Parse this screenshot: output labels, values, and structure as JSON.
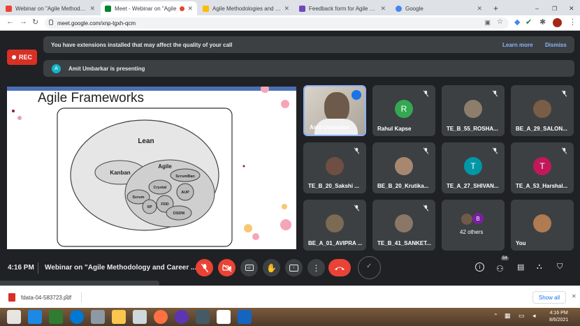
{
  "browser": {
    "tabs": [
      {
        "title": "Webinar on \"Agile Methodolo",
        "color": "#ea4335"
      },
      {
        "title": "Meet - Webinar on \"Agile",
        "color": "#00832d"
      },
      {
        "title": "Agile Methodologies and Care",
        "color": "#fbbc04"
      },
      {
        "title": "Feedback form for Agile Meth",
        "color": "#7248b9"
      },
      {
        "title": "Google",
        "color": "#4285f4"
      }
    ],
    "url": "meet.google.com/xnp-tgxh-qcm"
  },
  "meet": {
    "rec_label": "REC",
    "extension_notice": "You have extensions installed that may affect the quality of your call",
    "learn_more": "Learn more",
    "dismiss": "Dismiss",
    "presenter_initial": "A",
    "presenter_notice": "Amit Umbarkar is presenting",
    "slide": {
      "title": "Agile Frameworks",
      "labels": {
        "lean": "Lean",
        "kanban": "Kanban",
        "agile": "Agile",
        "scrumban": "ScrumBan",
        "crystal": "Crystal",
        "aup": "AUP",
        "scrum": "Scrum",
        "xp": "XP",
        "fdd": "FDD",
        "dsdm": "DSDM"
      }
    },
    "participants": [
      {
        "name": "Amit Umbarkar",
        "initial": "",
        "color": "#6d5a4a",
        "speaking": true
      },
      {
        "name": "Rahul Kapse",
        "initial": "R",
        "color": "#33a852"
      },
      {
        "name": "TE_B_55_ROSHA...",
        "initial": "",
        "color": "#8d7d6b"
      },
      {
        "name": "BE_A_29_SALON...",
        "initial": "",
        "color": "#7a5d47"
      },
      {
        "name": "TE_B_20_Sakshi ...",
        "initial": "",
        "color": "#6f4f43"
      },
      {
        "name": "BE_B_20_Krutika...",
        "initial": "",
        "color": "#a88770"
      },
      {
        "name": "TE_A_27_SHIVAN...",
        "initial": "T",
        "color": "#0097a7"
      },
      {
        "name": "TE_A_53_Harshal...",
        "initial": "T",
        "color": "#c2185b"
      },
      {
        "name": "BE_A_01_AVIPRA ...",
        "initial": "",
        "color": "#7c6a55"
      },
      {
        "name": "TE_B_41_SANKET...",
        "initial": "",
        "color": "#8a7766"
      },
      {
        "name": "42 others",
        "initial": "B",
        "color": "#7b1fa2"
      },
      {
        "name": "You",
        "initial": "",
        "color": "#b07a52"
      }
    ],
    "time": "4:16 PM",
    "meeting_title": "Webinar on \"Agile Methodology and Career ...",
    "people_count": "54"
  },
  "downloads": {
    "file": "fdata-04-583723.pdf",
    "show_all": "Show all"
  },
  "taskbar": {
    "time": "4:16 PM",
    "date": "8/6/2021"
  }
}
